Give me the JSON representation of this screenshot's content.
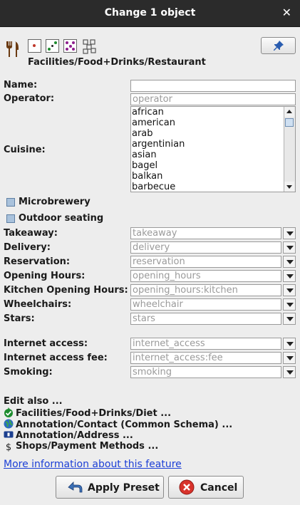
{
  "window": {
    "title": "Change 1 object",
    "close_symbol": "✕"
  },
  "preset": {
    "path": "Facilities/Food+Drinks/Restaurant"
  },
  "fields": {
    "name": {
      "label": "Name:",
      "value": ""
    },
    "operator": {
      "label": "Operator:",
      "placeholder": "operator"
    },
    "cuisine": {
      "label": "Cuisine:",
      "options": [
        "african",
        "american",
        "arab",
        "argentinian",
        "asian",
        "bagel",
        "balkan",
        "barbecue"
      ]
    },
    "microbrewery": {
      "label": "Microbrewery"
    },
    "outdoor_seating": {
      "label": "Outdoor seating"
    },
    "takeaway": {
      "label": "Takeaway:",
      "placeholder": "takeaway"
    },
    "delivery": {
      "label": "Delivery:",
      "placeholder": "delivery"
    },
    "reservation": {
      "label": "Reservation:",
      "placeholder": "reservation"
    },
    "opening_hours": {
      "label": "Opening Hours:",
      "placeholder": "opening_hours"
    },
    "kitchen_hours": {
      "label": "Kitchen Opening Hours:",
      "placeholder": "opening_hours:kitchen"
    },
    "wheelchairs": {
      "label": "Wheelchairs:",
      "placeholder": "wheelchair"
    },
    "stars": {
      "label": "Stars:",
      "placeholder": "stars"
    },
    "internet_access": {
      "label": "Internet access:",
      "placeholder": "internet_access"
    },
    "internet_access_fee": {
      "label": "Internet access fee:",
      "placeholder": "internet_access:fee"
    },
    "smoking": {
      "label": "Smoking:",
      "placeholder": "smoking"
    }
  },
  "edit_also": {
    "heading": "Edit also ...",
    "items": [
      {
        "label": "Facilities/Food+Drinks/Diet ...",
        "icon": "diet-icon"
      },
      {
        "label": "Annotation/Contact (Common Schema) ...",
        "icon": "globe-icon"
      },
      {
        "label": "Annotation/Address ...",
        "icon": "address-card-icon"
      },
      {
        "label": "Shops/Payment Methods ...",
        "icon": "dollar-icon"
      }
    ],
    "dollar_symbol": "$"
  },
  "link": {
    "more_info": "More information about this feature"
  },
  "buttons": {
    "apply": "Apply Preset",
    "cancel": "Cancel"
  },
  "colors": {
    "titlebar": "#2b2b2b",
    "link": "#1c3fd6",
    "cancel_icon": "#d8322b",
    "apply_icon": "#3b6fb6"
  }
}
